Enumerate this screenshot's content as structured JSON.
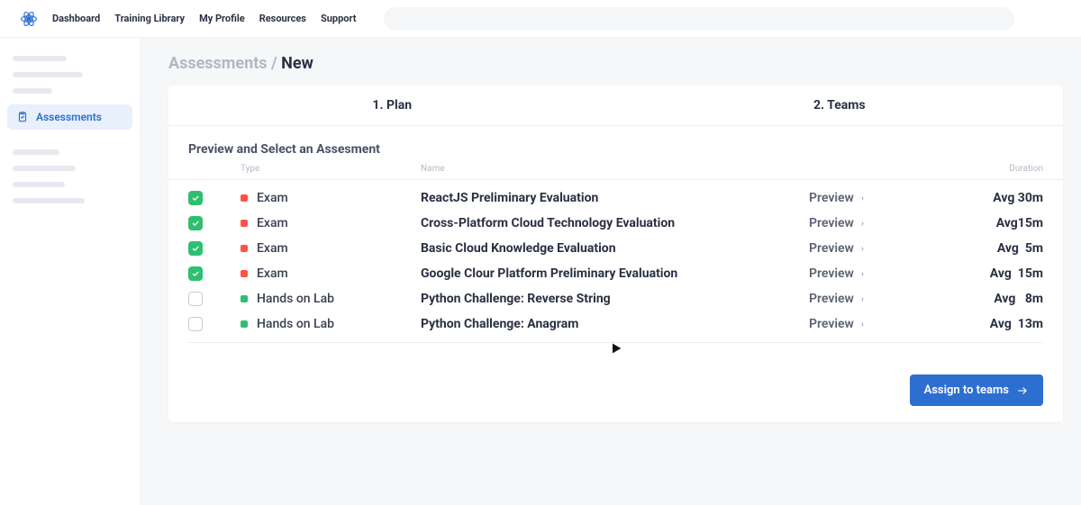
{
  "topnav": {
    "items": [
      "Dashboard",
      "Training Library",
      "My Profile",
      "Resources",
      "Support"
    ],
    "search_placeholder": ""
  },
  "sidebar": {
    "active_label": "Assessments"
  },
  "breadcrumb": {
    "parent": "Assessments / ",
    "current": "New"
  },
  "steps": {
    "step1": "1. Plan",
    "step2": "2. Teams"
  },
  "section": {
    "title": "Preview and Select an Assesment",
    "columns": {
      "type": "Type",
      "name": "Name",
      "duration": "Duration"
    }
  },
  "rows": [
    {
      "checked": true,
      "type_kind": "exam",
      "type_label": "Exam",
      "name": "ReactJS Preliminary Evaluation",
      "preview": "Preview",
      "duration": "Avg 30m"
    },
    {
      "checked": true,
      "type_kind": "exam",
      "type_label": "Exam",
      "name": "Cross-Platform Cloud Technology Evaluation",
      "preview": "Preview",
      "duration": "Avg15m"
    },
    {
      "checked": true,
      "type_kind": "exam",
      "type_label": "Exam",
      "name": "Basic Cloud Knowledge Evaluation",
      "preview": "Preview",
      "duration": "Avg  5m"
    },
    {
      "checked": true,
      "type_kind": "exam",
      "type_label": "Exam",
      "name": "Google Clour Platform Preliminary Evaluation",
      "preview": "Preview",
      "duration": "Avg  15m"
    },
    {
      "checked": false,
      "type_kind": "lab",
      "type_label": "Hands on Lab",
      "name": "Python Challenge: Reverse String",
      "preview": "Preview",
      "duration": "Avg   8m"
    },
    {
      "checked": false,
      "type_kind": "lab",
      "type_label": "Hands on Lab",
      "name": "Python Challenge: Anagram",
      "preview": "Preview",
      "duration": "Avg  13m"
    }
  ],
  "actions": {
    "primary": "Assign to teams"
  }
}
